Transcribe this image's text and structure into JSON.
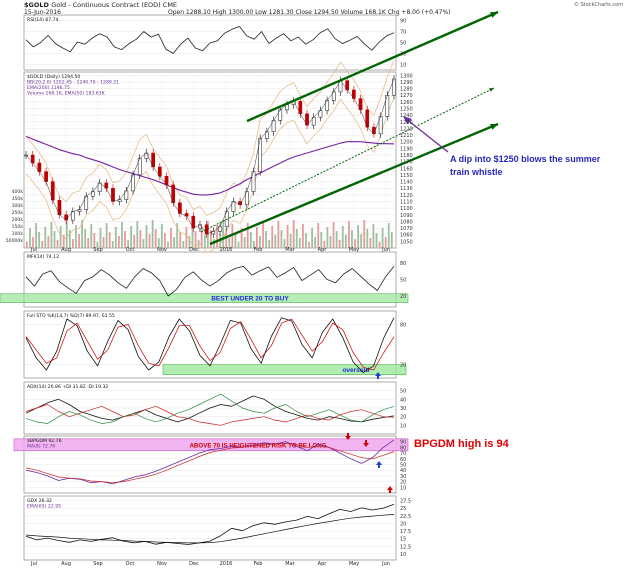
{
  "header": {
    "symbol": "$GOLD",
    "name": "Gold - Continuous Contract (EOD) CME",
    "date": "15-Jun-2016",
    "ohlc": "Open 1288.10  High 1300.00  Low 1281.30  Close 1294.50  Volume 168.1K  Chg +8.00 (+0.47%)",
    "watermark": "© StockCharts.com"
  },
  "annotations": {
    "bpgdm_high": "BPGDM high is 94",
    "dip": "A dip into $1250 blows the summer train whistle",
    "mfi_band": "BEST UNDER 20 TO BUY",
    "sto_band": "oversold",
    "bpgdm_band": "ABOVE 70 IS HEIGHTENED RISK TO BE LONG"
  },
  "x_tick_labels": [
    "Jul",
    "Aug",
    "Sep",
    "Oct",
    "Nov",
    "Dec",
    "2016",
    "Feb",
    "Mar",
    "Apr",
    "May",
    "Jun"
  ],
  "colors": {
    "price_up": "#111111",
    "price_down": "#c00000",
    "trend": "#006400",
    "ma_200": "#7a1fa2",
    "bands": "#e5b67f",
    "volume_up": "#9fbf9f",
    "volume_down": "#e79a9a",
    "mfi_zone": "#9ee79e",
    "bpgdm_zone": "#f0a8f0",
    "arrow_red": "#dd0000",
    "arrow_blue": "#1c3fd6"
  },
  "chart_data": [
    {
      "type": "line",
      "panel": "rsi",
      "legend": "RSI(14) 67.74",
      "y_ticks": [
        90,
        70,
        50,
        30,
        10
      ],
      "series": [
        {
          "name": "RSI(14)",
          "values": [
            55,
            42,
            50,
            63,
            48,
            40,
            33,
            51,
            47,
            58,
            66,
            60,
            42,
            37,
            48,
            56,
            70,
            60,
            65,
            38,
            30,
            47,
            58,
            40,
            35,
            49,
            53,
            67,
            74,
            79,
            62,
            56,
            70,
            48,
            58,
            66,
            53,
            60,
            47,
            55,
            68,
            75,
            57,
            48,
            54,
            61,
            47,
            36,
            51,
            62,
            67.74
          ]
        }
      ]
    },
    {
      "type": "line",
      "panel": "price",
      "legend": [
        "$GOLD (Daily) 1294.50",
        "BB(20,2.0) 1252.45 - 1240.70 - 1289.21",
        "EMA(200) 1196.75",
        "Volume 168.1K, EMA(50) 183.63K"
      ],
      "y_ticks": [
        1300,
        1290,
        1280,
        1270,
        1260,
        1250,
        1240,
        1230,
        1220,
        1210,
        1200,
        1190,
        1180,
        1170,
        1160,
        1150,
        1140,
        1130,
        1120,
        1110,
        1100,
        1090,
        1080,
        1070,
        1060,
        1050
      ],
      "volume_ticks": [
        "400k",
        "350k",
        "300k",
        "250k",
        "200k",
        "150k",
        "100k",
        "50000k"
      ],
      "series": [
        {
          "name": "$GOLD (Daily)",
          "values": [
            1180,
            1168,
            1155,
            1140,
            1112,
            1090,
            1082,
            1095,
            1098,
            1118,
            1125,
            1138,
            1130,
            1110,
            1113,
            1126,
            1150,
            1175,
            1183,
            1162,
            1148,
            1135,
            1108,
            1092,
            1088,
            1070,
            1075,
            1061,
            1065,
            1072,
            1095,
            1110,
            1105,
            1125,
            1155,
            1205,
            1215,
            1232,
            1248,
            1256,
            1261,
            1242,
            1225,
            1237,
            1247,
            1262,
            1275,
            1292,
            1278,
            1265,
            1248,
            1222,
            1212,
            1238,
            1270,
            1294.5
          ]
        },
        {
          "name": "EMA(200)",
          "values": [
            1208,
            1204,
            1200,
            1196,
            1192,
            1188,
            1185,
            1182,
            1180,
            1176,
            1173,
            1170,
            1166,
            1162,
            1158,
            1155,
            1152,
            1149,
            1146,
            1143,
            1139,
            1135,
            1131,
            1127,
            1124,
            1121,
            1120,
            1120,
            1121,
            1123,
            1127,
            1132,
            1137,
            1143,
            1148,
            1153,
            1158,
            1163,
            1168,
            1173,
            1177,
            1180,
            1183,
            1186,
            1189,
            1192,
            1195,
            1198,
            1200,
            1200,
            1200,
            1199,
            1198,
            1197,
            1197,
            1196.75
          ]
        }
      ]
    },
    {
      "type": "line",
      "panel": "mfi",
      "legend": "MFI(14) 74.12",
      "y_ticks": [
        80,
        50,
        20
      ],
      "series": [
        {
          "name": "MFI(14)",
          "values": [
            55,
            38,
            60,
            66,
            46,
            35,
            25,
            48,
            55,
            68,
            58,
            44,
            34,
            55,
            70,
            62,
            48,
            20,
            32,
            54,
            64,
            49,
            38,
            48,
            62,
            70,
            74,
            58,
            66,
            73,
            54,
            62,
            72,
            48,
            58,
            68,
            50,
            44,
            60,
            70,
            56,
            42,
            30,
            55,
            74.12
          ]
        }
      ]
    },
    {
      "type": "line",
      "panel": "full_sto",
      "legend": "Full STO %K(14,7) %D(7) 89.97, 61.55",
      "y_ticks": [
        80,
        20
      ],
      "series": [
        {
          "name": "%K(14,7)",
          "values": [
            60,
            30,
            12,
            40,
            88,
            78,
            40,
            18,
            55,
            86,
            72,
            32,
            12,
            24,
            62,
            88,
            70,
            34,
            18,
            50,
            86,
            82,
            44,
            22,
            62,
            90,
            85,
            50,
            30,
            68,
            88,
            60,
            24,
            8,
            18,
            60,
            89.97
          ]
        },
        {
          "name": "%D(7)",
          "values": [
            62,
            42,
            22,
            30,
            70,
            82,
            55,
            28,
            42,
            76,
            80,
            48,
            22,
            18,
            46,
            78,
            78,
            48,
            26,
            38,
            74,
            84,
            58,
            30,
            48,
            82,
            88,
            64,
            40,
            54,
            82,
            72,
            38,
            16,
            12,
            38,
            61.55
          ]
        }
      ]
    },
    {
      "type": "line",
      "panel": "adx",
      "legend": "ADX(14) 20.86  +DI 31.82  -DI 19.32",
      "y_ticks": [
        50,
        40,
        30,
        20,
        10
      ],
      "series": [
        {
          "name": "ADX(14)",
          "values": [
            24,
            30,
            36,
            40,
            34,
            26,
            22,
            18,
            16,
            20,
            24,
            28,
            22,
            18,
            14,
            18,
            24,
            30,
            34,
            32,
            38,
            44,
            40,
            32,
            26,
            22,
            18,
            16,
            20,
            18,
            15,
            14,
            17,
            19,
            20.86
          ]
        },
        {
          "name": "+DI",
          "values": [
            18,
            14,
            12,
            20,
            26,
            22,
            16,
            12,
            14,
            20,
            24,
            18,
            14,
            18,
            24,
            28,
            34,
            40,
            46,
            38,
            30,
            26,
            24,
            30,
            34,
            26,
            20,
            24,
            28,
            22,
            16,
            14,
            22,
            28,
            31.82
          ]
        },
        {
          "name": "-DI",
          "values": [
            26,
            30,
            34,
            26,
            20,
            24,
            28,
            32,
            26,
            20,
            22,
            28,
            32,
            26,
            20,
            18,
            14,
            12,
            10,
            14,
            16,
            18,
            20,
            16,
            14,
            18,
            22,
            18,
            16,
            22,
            26,
            28,
            24,
            20,
            19.32
          ]
        }
      ]
    },
    {
      "type": "line",
      "panel": "bpgdm",
      "legend": [
        "$BPGDM 92.76",
        "MA(8) 72.76"
      ],
      "y_ticks": [
        90,
        80,
        70,
        60,
        50,
        40,
        30,
        20,
        10
      ],
      "series": [
        {
          "name": "$BPGDM",
          "values": [
            40,
            36,
            30,
            22,
            26,
            24,
            18,
            20,
            16,
            22,
            28,
            32,
            38,
            46,
            54,
            62,
            70,
            76,
            78,
            82,
            80,
            84,
            88,
            86,
            90,
            82,
            74,
            86,
            80,
            70,
            60,
            52,
            62,
            80,
            92.76
          ]
        },
        {
          "name": "MA(8)",
          "values": [
            44,
            40,
            34,
            28,
            26,
            25,
            21,
            20,
            18,
            20,
            24,
            28,
            33,
            40,
            48,
            56,
            64,
            71,
            75,
            79,
            80,
            82,
            85,
            86,
            87,
            85,
            80,
            82,
            80,
            74,
            68,
            62,
            60,
            66,
            72.76
          ]
        }
      ]
    },
    {
      "type": "line",
      "panel": "gdx",
      "legend": [
        "GDX 26.32",
        "EMA(65) 22.95"
      ],
      "y_ticks": [
        27.5,
        25.0,
        22.5,
        20.0,
        17.5,
        15.0,
        12.5,
        10.0
      ],
      "series": [
        {
          "name": "GDX",
          "values": [
            15.8,
            14.6,
            15.2,
            14.4,
            13.8,
            14.6,
            14.1,
            14.8,
            15.3,
            14.2,
            13.6,
            14.1,
            13.2,
            13.8,
            13.4,
            13.1,
            13.6,
            14.2,
            16.0,
            18.4,
            17.6,
            19.3,
            20.2,
            19.7,
            20.5,
            21.1,
            22.3,
            21.6,
            23.2,
            24.6,
            23.9,
            25.1,
            24.4,
            25.0,
            26.32
          ]
        },
        {
          "name": "EMA(65)",
          "values": [
            16.2,
            15.9,
            15.7,
            15.5,
            15.2,
            15.0,
            14.8,
            14.6,
            14.5,
            14.4,
            14.2,
            14.1,
            13.9,
            13.8,
            13.7,
            13.6,
            13.6,
            13.7,
            14.0,
            14.6,
            15.2,
            15.9,
            16.6,
            17.3,
            18.0,
            18.7,
            19.4,
            20.0,
            20.6,
            21.2,
            21.7,
            22.1,
            22.4,
            22.7,
            22.95
          ]
        }
      ]
    }
  ]
}
